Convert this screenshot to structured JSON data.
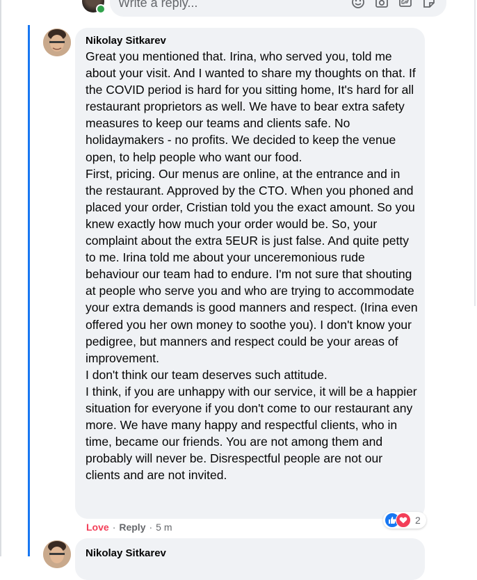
{
  "reply_box": {
    "placeholder": "Write a reply...",
    "icons": [
      "emoji-icon",
      "camera-icon",
      "gif-icon",
      "sticker-icon"
    ]
  },
  "comment": {
    "author": "Nikolay Sitkarev",
    "paragraphs": [
      "Great you mentioned that. Irina, who served you, told me about your visit. And I wanted to share my thoughts on that. If the COVID period is hard for you sitting home, It's hard for all restaurant proprietors as well. We have to bear extra safety measures to keep our teams and clients safe. No holidaymakers - no profits. We decided to keep the venue open, to help people who want our food.",
      "First, pricing. Our menus are online, at the entrance and in the restaurant. Approved by the CTO. When you phoned and placed your order, Cristian told you the exact amount. So you knew exactly how much your order would be. So, your complaint about the extra 5EUR is just false. And quite petty to me. Irina told me about your unceremonious rude behaviour our team had to endure. I'm not sure that shouting at people who serve you and who are trying to accommodate your extra demands is good manners and respect. (Irina even offered you her own money to soothe you). I don't know your pedigree, but manners and respect could be your areas of improvement.",
      "I don't think our team deserves such attitude.",
      "I think, if you are unhappy with our service, it will be a happier situation for everyone if you don't come to our restaurant any more. We have many happy and respectful clients, who in time, became our friends. You are not among them and probably will never be. Disrespectful people are not our clients and are not invited."
    ],
    "actions": {
      "love": "Love",
      "reply": "Reply",
      "separator": "·",
      "time": "5 m"
    },
    "reactions": {
      "count": "2",
      "types": [
        "like-icon",
        "heart-icon"
      ]
    },
    "colors": {
      "love": "#f33e58",
      "like": "#1877f2",
      "bubble": "#f0f2f5",
      "thread": "#1877f2"
    }
  },
  "next_comment": {
    "author": "Nikolay Sitkarev"
  }
}
